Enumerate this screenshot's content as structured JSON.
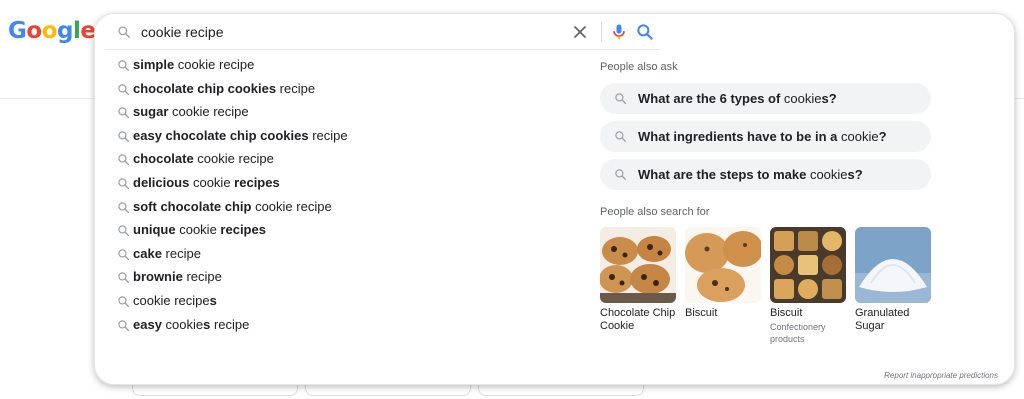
{
  "logo": {
    "text": "Google",
    "letters": [
      "G",
      "o",
      "o",
      "g",
      "l",
      "e"
    ],
    "colors": [
      "#4285F4",
      "#EA4335",
      "#FBBC05",
      "#4285F4",
      "#34A853",
      "#EA4335"
    ]
  },
  "search": {
    "value": "cookie recipe",
    "clear_icon": "close-icon",
    "mic_icon": "microphone-icon",
    "search_icon": "search-icon"
  },
  "suggestions": [
    {
      "parts": [
        {
          "t": "simple",
          "b": true
        },
        {
          "t": " cookie recipe",
          "b": false
        }
      ]
    },
    {
      "parts": [
        {
          "t": "chocolate chip cookies",
          "b": true
        },
        {
          "t": " recipe",
          "b": false
        }
      ]
    },
    {
      "parts": [
        {
          "t": "sugar",
          "b": true
        },
        {
          "t": " cookie recipe",
          "b": false
        }
      ]
    },
    {
      "parts": [
        {
          "t": "easy chocolate chip cookies",
          "b": true
        },
        {
          "t": " recipe",
          "b": false
        }
      ]
    },
    {
      "parts": [
        {
          "t": "chocolate",
          "b": true
        },
        {
          "t": " cookie recipe",
          "b": false
        }
      ]
    },
    {
      "parts": [
        {
          "t": "delicious",
          "b": true
        },
        {
          "t": " cookie ",
          "b": false
        },
        {
          "t": "recipes",
          "b": true
        }
      ]
    },
    {
      "parts": [
        {
          "t": "soft chocolate chip",
          "b": true
        },
        {
          "t": " cookie recipe",
          "b": false
        }
      ]
    },
    {
      "parts": [
        {
          "t": "unique",
          "b": true
        },
        {
          "t": " cookie ",
          "b": false
        },
        {
          "t": "recipes",
          "b": true
        }
      ]
    },
    {
      "parts": [
        {
          "t": "cake",
          "b": true
        },
        {
          "t": " recipe",
          "b": false
        }
      ]
    },
    {
      "parts": [
        {
          "t": "brownie",
          "b": true
        },
        {
          "t": " recipe",
          "b": false
        }
      ]
    },
    {
      "parts": [
        {
          "t": "cookie recipe",
          "b": false
        },
        {
          "t": "s",
          "b": true
        }
      ]
    },
    {
      "parts": [
        {
          "t": "easy",
          "b": true
        },
        {
          "t": " cookie",
          "b": false
        },
        {
          "t": "s",
          "b": true
        },
        {
          "t": " recipe",
          "b": false
        }
      ]
    }
  ],
  "people_also_ask": {
    "label": "People also ask",
    "questions": [
      {
        "parts": [
          {
            "t": "What are the 6 types of ",
            "b": true
          },
          {
            "t": "cookie",
            "b": false
          },
          {
            "t": "s?",
            "b": true
          }
        ]
      },
      {
        "parts": [
          {
            "t": "What ingredients have to be in a ",
            "b": true
          },
          {
            "t": "cookie",
            "b": false
          },
          {
            "t": "?",
            "b": true
          }
        ]
      },
      {
        "parts": [
          {
            "t": "What are the steps to make ",
            "b": true
          },
          {
            "t": "cookie",
            "b": false
          },
          {
            "t": "s?",
            "b": true
          }
        ]
      }
    ]
  },
  "people_also_search": {
    "label": "People also search for",
    "cards": [
      {
        "title": "Chocolate Chip Cookie",
        "subtitle": "",
        "image": "chocolate-chip-cookies-image"
      },
      {
        "title": "Biscuit",
        "subtitle": "",
        "image": "biscuit-image"
      },
      {
        "title": "Biscuit",
        "subtitle": "Confectionery products",
        "image": "biscuit-tin-image"
      },
      {
        "title": "Granulated Sugar",
        "subtitle": "",
        "image": "sugar-image"
      }
    ]
  },
  "report_link": "Report inappropriate predictions",
  "colors": {
    "accent_blue": "#4285F4",
    "mic_red": "#EA4335",
    "chip_bg": "#f1f3f4",
    "text_secondary": "#5f6368"
  }
}
